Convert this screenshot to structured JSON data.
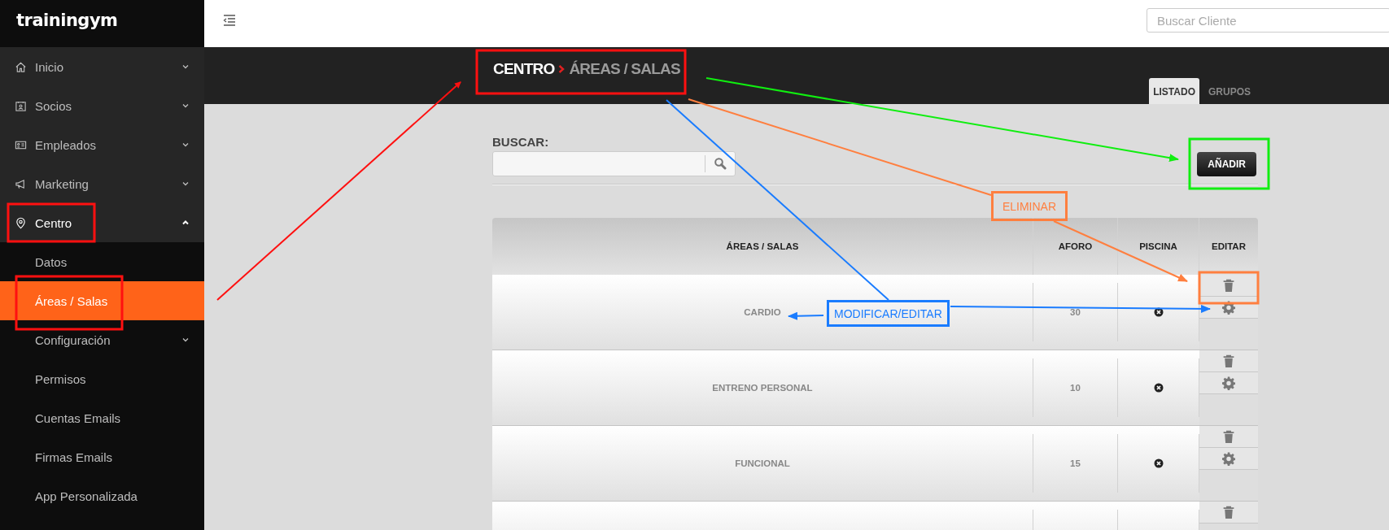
{
  "sidebar": {
    "logo": "trainingym",
    "items": [
      {
        "label": "Inicio",
        "expanded": false,
        "selected": false
      },
      {
        "label": "Socios",
        "expanded": false,
        "selected": false
      },
      {
        "label": "Empleados",
        "expanded": false,
        "selected": false
      },
      {
        "label": "Marketing",
        "expanded": false,
        "selected": false
      },
      {
        "label": "Centro",
        "expanded": true,
        "selected": true,
        "children": [
          {
            "label": "Datos",
            "selected": false,
            "expandable": false
          },
          {
            "label": "Áreas / Salas",
            "selected": true,
            "expandable": false
          },
          {
            "label": "Configuración",
            "selected": false,
            "expandable": true
          },
          {
            "label": "Permisos",
            "selected": false,
            "expandable": false
          },
          {
            "label": "Cuentas Emails",
            "selected": false,
            "expandable": false
          },
          {
            "label": "Firmas Emails",
            "selected": false,
            "expandable": false
          },
          {
            "label": "App Personalizada",
            "selected": false,
            "expandable": false
          }
        ]
      }
    ]
  },
  "topbar": {
    "search": {
      "placeholder": "Buscar Cliente"
    }
  },
  "breadcrumb": [
    "CENTRO",
    "ÁREAS / SALAS"
  ],
  "tabs": [
    {
      "label": "LISTADO",
      "selected": true
    },
    {
      "label": "GRUPOS",
      "selected": false
    }
  ],
  "search": {
    "label": "BUSCAR:"
  },
  "add_button": "AÑADIR",
  "table": {
    "columns": [
      "ÁREAS / SALAS",
      "AFORO",
      "PISCINA",
      "EDITAR"
    ],
    "rows": [
      {
        "name": "CARDIO",
        "aforo": "30",
        "piscina": false
      },
      {
        "name": "ENTRENO PERSONAL",
        "aforo": "10",
        "piscina": false
      },
      {
        "name": "FUNCIONAL",
        "aforo": "15",
        "piscina": false
      }
    ]
  },
  "annotations": [
    {
      "text": "ELIMINAR",
      "color": "#ff7f3f"
    },
    {
      "text": "MODIFICAR/EDITAR",
      "color": "#1a7cff"
    }
  ]
}
